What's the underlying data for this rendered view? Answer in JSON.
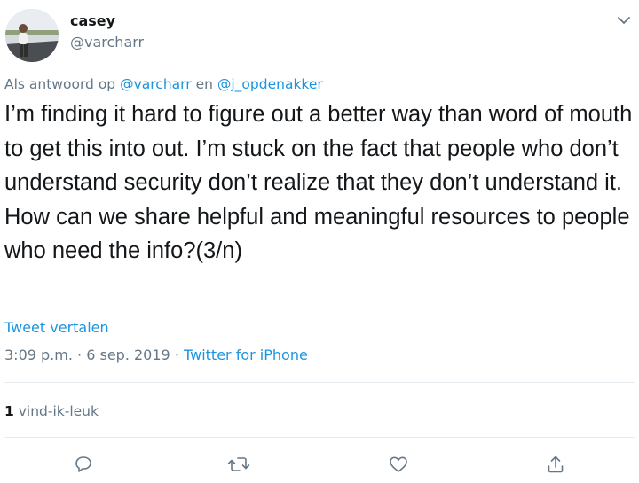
{
  "author": {
    "display_name": "casey",
    "handle": "@varcharr"
  },
  "reply_context": {
    "prefix": "Als antwoord op",
    "mention_1": "@varcharr",
    "connector": "en",
    "mention_2": "@j_opdenakker"
  },
  "tweet": {
    "text": "I’m finding it hard to figure out a better way than word of mouth to get this into out. I’m stuck on the fact that people who don’t understand security don’t realize that they don’t understand it. How can we share helpful and meaningful resources to people who need the info?(3/n)",
    "translate_label": "Tweet vertalen",
    "time": "3:09 p.m.",
    "separator_1": "·",
    "date": "6 sep. 2019",
    "separator_2": "·",
    "source": "Twitter for iPhone"
  },
  "stats": {
    "likes_count": "1",
    "likes_label": "vind-ik-leuk"
  },
  "icons": {
    "caret": "chevron-down-icon",
    "reply": "reply-icon",
    "retweet": "retweet-icon",
    "like": "heart-icon",
    "share": "share-icon"
  },
  "colors": {
    "text": "#14171a",
    "secondary": "#657786",
    "link": "#1b95e0",
    "divider": "#e6ecf0"
  }
}
